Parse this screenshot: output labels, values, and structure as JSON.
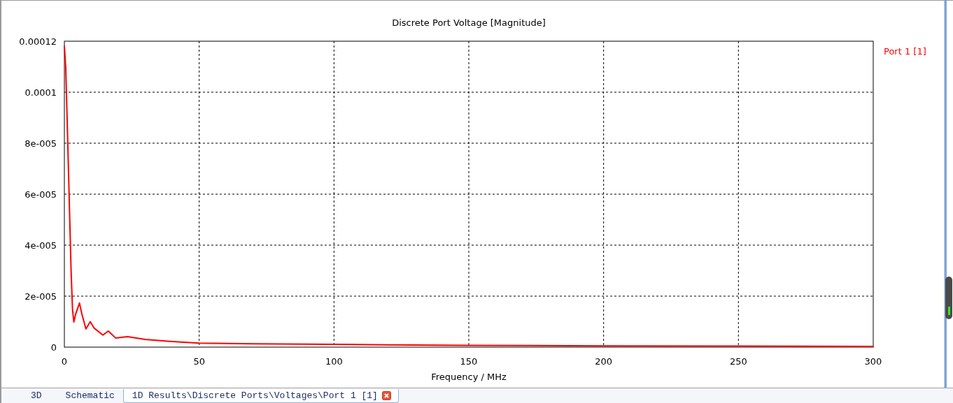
{
  "plot": {
    "chart_data": {
      "type": "line",
      "grid": true,
      "title": "Discrete Port Voltage [Magnitude]",
      "xlabel": "Frequency / MHz",
      "xlim": [
        0,
        300
      ],
      "ylim": [
        0,
        0.00012
      ],
      "xticks": [
        0,
        50,
        100,
        150,
        200,
        250,
        300
      ],
      "yticks": [
        {
          "value": 0,
          "label": "0"
        },
        {
          "value": 2e-05,
          "label": "2e-005"
        },
        {
          "value": 4e-05,
          "label": "4e-005"
        },
        {
          "value": 6e-05,
          "label": "6e-005"
        },
        {
          "value": 8e-05,
          "label": "8e-005"
        },
        {
          "value": 0.0001,
          "label": "0.0001"
        },
        {
          "value": 0.00012,
          "label": "0.00012"
        }
      ],
      "x": [
        0,
        0.5,
        1,
        1.5,
        2,
        2.5,
        3,
        3.5,
        4.2,
        5.6,
        6.5,
        8,
        9.6,
        11,
        14.3,
        16.3,
        19,
        23.4,
        30,
        40,
        50,
        70,
        100,
        120,
        150,
        200,
        250,
        300
      ],
      "series": [
        {
          "name": "Port 1 [1]",
          "color": "#ff0000",
          "values": [
            0.000118,
            0.00011,
            9e-05,
            7e-05,
            5e-05,
            3e-05,
            1.5e-05,
            9.9e-06,
            1.3e-05,
            1.73e-05,
            1.3e-05,
            7.1e-06,
            1e-05,
            7.5e-06,
            4.7e-06,
            6.3e-06,
            3.6e-06,
            4.1e-06,
            3e-06,
            2.2e-06,
            1.6e-06,
            1.3e-06,
            1.1e-06,
            9e-07,
            7e-07,
            5e-07,
            4e-07,
            3e-07
          ]
        }
      ]
    }
  },
  "tabs": [
    {
      "label": "3D",
      "selected": false
    },
    {
      "label": "Schematic",
      "selected": false
    },
    {
      "label": "1D Results\\Discrete Ports\\Voltages\\Port 1 [1]",
      "selected": true,
      "closable": true
    }
  ]
}
